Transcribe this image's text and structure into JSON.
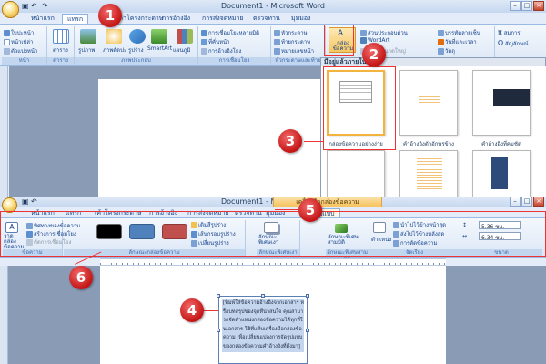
{
  "top_window": {
    "title": "Document1 - Microsoft Word",
    "tabs": [
      "หน้าแรก",
      "แทรก",
      "เค้าโครงกระดาษ",
      "การอ้างอิง",
      "การส่งจดหมาย",
      "ตรวจทาน",
      "มุมมอง"
    ],
    "active_tab": "แทรก",
    "groups": {
      "pages": {
        "label": "หน้า",
        "items": [
          "ใบปะหน้า",
          "หน้าเปล่า",
          "ตัวแบ่งหน้า"
        ]
      },
      "tables": {
        "label": "ตาราง",
        "items": [
          "ตาราง"
        ]
      },
      "illustrations": {
        "label": "ภาพประกอบ",
        "items": [
          "รูปภาพ",
          "ภาพตัดปะ",
          "รูปร่าง",
          "SmartArt",
          "แผนภูมิ"
        ]
      },
      "links": {
        "label": "การเชื่อมโยง",
        "items": [
          "การเชื่อมโยงหลายมิติ",
          "ที่คั่นหน้า",
          "การอ้างอิงโยง"
        ]
      },
      "header_footer": {
        "label": "หัวกระดาษและท้ายกระดาษ",
        "items": [
          "หัวกระดาษ",
          "ท้ายกระดาษ",
          "หมายเลขหน้า"
        ]
      },
      "text": {
        "items": [
          "กล่องข้อความ",
          "ส่วนประกอบด่วน",
          "WordArt",
          "อักษรขนาดใหญ่"
        ]
      },
      "right": {
        "items": [
          "บรรทัดลายเซ็น",
          "วันที่และเวลา",
          "วัตถุ"
        ]
      },
      "symbols": {
        "items": [
          "สมการ",
          "สัญลักษณ์"
        ]
      }
    },
    "gallery_header": "มีอยู่แล้วภายใน",
    "gallery_items": [
      "กล่องข้อความอย่างง่าย",
      "คำอ้างอิงตัวอักษรข้าง",
      "คำอ้างอิงที่คมชัด"
    ]
  },
  "bottom_window": {
    "title": "Document1 - Microsoft Word",
    "context_tab": "เครื่องมือกล่องข้อความ",
    "tabs": [
      "หน้าแรก",
      "แทรก",
      "เค้าโครงกระดาษ",
      "การอ้างอิง",
      "การส่งจดหมาย",
      "ตรวจทาน",
      "มุมมอง",
      "รูปแบบ"
    ],
    "active_tab": "รูปแบบ",
    "groups": {
      "text": {
        "label": "ข้อความ",
        "items": [
          "วาดกล่องข้อความ",
          "ทิศทางของข้อความ",
          "สร้างการเชื่อมโยง",
          "ตัดการเชื่อมโยง"
        ]
      },
      "styles": {
        "label": "ลักษณะกล่องข้อความ",
        "items": [
          "เติมสีรูปร่าง",
          "เส้นกรอบรูปร่าง",
          "เปลี่ยนรูปร่าง"
        ]
      },
      "shadow": {
        "label": "ลักษณะพิเศษเงา",
        "items": [
          "ลักษณะพิเศษเงา"
        ]
      },
      "threed": {
        "label": "ลักษณะพิเศษสามมิติ",
        "items": [
          "ลักษณะพิเศษสามมิติ"
        ]
      },
      "arrange": {
        "label": "จัดเรียง",
        "items": [
          "ตำแหน่ง",
          "นำไปไว้ข้างหน้าสุด",
          "ส่งไปไว้ข้างหลังสุด",
          "การตัดข้อความ"
        ]
      },
      "size": {
        "label": "ขนาด",
        "height": "5.36 ซม.",
        "width": "6.34 ซม."
      }
    },
    "textbox_text": "[พิมพ์ใส่ข้อความอ้างอิงจากเอกสาร หรือบทสรุปของจุดที่น่าสนใจ คุณสามารถจัดตำแหน่งกล่องข้อความได้ทุกที่ในเอกสาร ใช้ที่แท็บเครื่องมือกล่องข้อความ เพื่อเปลี่ยนแปลงการจัดรูปแบบของกล่องข้อความคำอ้างอิงที่ดึงมา]"
  },
  "badges": [
    "1",
    "2",
    "3",
    "4",
    "5",
    "6"
  ],
  "colors": {
    "badge": "#c41515",
    "ribbon": "#dbe7f6",
    "swatch_black": "#000000",
    "swatch_blue": "#4f81bd",
    "swatch_red": "#c0504d"
  }
}
